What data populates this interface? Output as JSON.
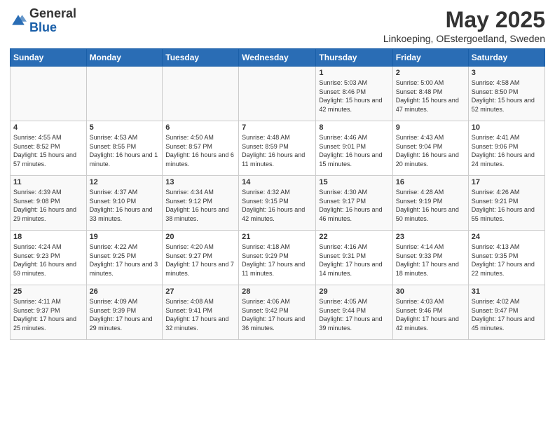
{
  "logo": {
    "general": "General",
    "blue": "Blue"
  },
  "header": {
    "month": "May 2025",
    "location": "Linkoeping, OEstergoetland, Sweden"
  },
  "weekdays": [
    "Sunday",
    "Monday",
    "Tuesday",
    "Wednesday",
    "Thursday",
    "Friday",
    "Saturday"
  ],
  "weeks": [
    [
      {
        "day": "",
        "empty": true
      },
      {
        "day": "",
        "empty": true
      },
      {
        "day": "",
        "empty": true
      },
      {
        "day": "",
        "empty": true
      },
      {
        "day": "1",
        "sunrise": "5:03 AM",
        "sunset": "8:46 PM",
        "daylight": "15 hours and 42 minutes."
      },
      {
        "day": "2",
        "sunrise": "5:00 AM",
        "sunset": "8:48 PM",
        "daylight": "15 hours and 47 minutes."
      },
      {
        "day": "3",
        "sunrise": "4:58 AM",
        "sunset": "8:50 PM",
        "daylight": "15 hours and 52 minutes."
      }
    ],
    [
      {
        "day": "4",
        "sunrise": "4:55 AM",
        "sunset": "8:52 PM",
        "daylight": "15 hours and 57 minutes."
      },
      {
        "day": "5",
        "sunrise": "4:53 AM",
        "sunset": "8:55 PM",
        "daylight": "16 hours and 1 minute."
      },
      {
        "day": "6",
        "sunrise": "4:50 AM",
        "sunset": "8:57 PM",
        "daylight": "16 hours and 6 minutes."
      },
      {
        "day": "7",
        "sunrise": "4:48 AM",
        "sunset": "8:59 PM",
        "daylight": "16 hours and 11 minutes."
      },
      {
        "day": "8",
        "sunrise": "4:46 AM",
        "sunset": "9:01 PM",
        "daylight": "16 hours and 15 minutes."
      },
      {
        "day": "9",
        "sunrise": "4:43 AM",
        "sunset": "9:04 PM",
        "daylight": "16 hours and 20 minutes."
      },
      {
        "day": "10",
        "sunrise": "4:41 AM",
        "sunset": "9:06 PM",
        "daylight": "16 hours and 24 minutes."
      }
    ],
    [
      {
        "day": "11",
        "sunrise": "4:39 AM",
        "sunset": "9:08 PM",
        "daylight": "16 hours and 29 minutes."
      },
      {
        "day": "12",
        "sunrise": "4:37 AM",
        "sunset": "9:10 PM",
        "daylight": "16 hours and 33 minutes."
      },
      {
        "day": "13",
        "sunrise": "4:34 AM",
        "sunset": "9:12 PM",
        "daylight": "16 hours and 38 minutes."
      },
      {
        "day": "14",
        "sunrise": "4:32 AM",
        "sunset": "9:15 PM",
        "daylight": "16 hours and 42 minutes."
      },
      {
        "day": "15",
        "sunrise": "4:30 AM",
        "sunset": "9:17 PM",
        "daylight": "16 hours and 46 minutes."
      },
      {
        "day": "16",
        "sunrise": "4:28 AM",
        "sunset": "9:19 PM",
        "daylight": "16 hours and 50 minutes."
      },
      {
        "day": "17",
        "sunrise": "4:26 AM",
        "sunset": "9:21 PM",
        "daylight": "16 hours and 55 minutes."
      }
    ],
    [
      {
        "day": "18",
        "sunrise": "4:24 AM",
        "sunset": "9:23 PM",
        "daylight": "16 hours and 59 minutes."
      },
      {
        "day": "19",
        "sunrise": "4:22 AM",
        "sunset": "9:25 PM",
        "daylight": "17 hours and 3 minutes."
      },
      {
        "day": "20",
        "sunrise": "4:20 AM",
        "sunset": "9:27 PM",
        "daylight": "17 hours and 7 minutes."
      },
      {
        "day": "21",
        "sunrise": "4:18 AM",
        "sunset": "9:29 PM",
        "daylight": "17 hours and 11 minutes."
      },
      {
        "day": "22",
        "sunrise": "4:16 AM",
        "sunset": "9:31 PM",
        "daylight": "17 hours and 14 minutes."
      },
      {
        "day": "23",
        "sunrise": "4:14 AM",
        "sunset": "9:33 PM",
        "daylight": "17 hours and 18 minutes."
      },
      {
        "day": "24",
        "sunrise": "4:13 AM",
        "sunset": "9:35 PM",
        "daylight": "17 hours and 22 minutes."
      }
    ],
    [
      {
        "day": "25",
        "sunrise": "4:11 AM",
        "sunset": "9:37 PM",
        "daylight": "17 hours and 25 minutes."
      },
      {
        "day": "26",
        "sunrise": "4:09 AM",
        "sunset": "9:39 PM",
        "daylight": "17 hours and 29 minutes."
      },
      {
        "day": "27",
        "sunrise": "4:08 AM",
        "sunset": "9:41 PM",
        "daylight": "17 hours and 32 minutes."
      },
      {
        "day": "28",
        "sunrise": "4:06 AM",
        "sunset": "9:42 PM",
        "daylight": "17 hours and 36 minutes."
      },
      {
        "day": "29",
        "sunrise": "4:05 AM",
        "sunset": "9:44 PM",
        "daylight": "17 hours and 39 minutes."
      },
      {
        "day": "30",
        "sunrise": "4:03 AM",
        "sunset": "9:46 PM",
        "daylight": "17 hours and 42 minutes."
      },
      {
        "day": "31",
        "sunrise": "4:02 AM",
        "sunset": "9:47 PM",
        "daylight": "17 hours and 45 minutes."
      }
    ]
  ]
}
